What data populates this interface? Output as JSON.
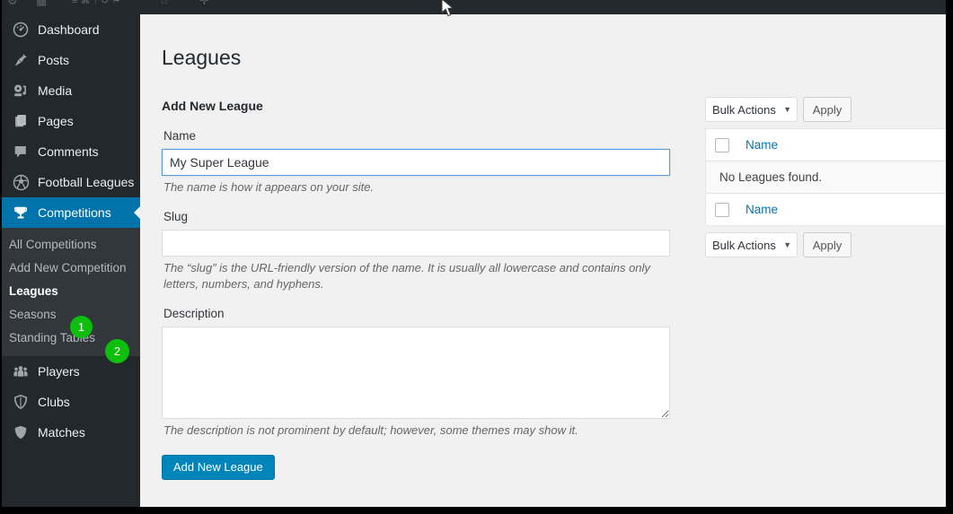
{
  "window": {
    "admin_bar_ghost_left": "≡ ⌘ ↑ ↺  ⚑",
    "cursor_icon": "mouse-pointer"
  },
  "sidebar": {
    "items": [
      {
        "label": "Dashboard",
        "icon": "gauge-icon",
        "active": false
      },
      {
        "label": "Posts",
        "icon": "pushpin-icon",
        "active": false
      },
      {
        "label": "Media",
        "icon": "media-icon",
        "active": false
      },
      {
        "label": "Pages",
        "icon": "pages-icon",
        "active": false
      },
      {
        "label": "Comments",
        "icon": "comment-bubble-icon",
        "active": false
      },
      {
        "label": "Football Leagues",
        "icon": "soccer-ball-icon",
        "active": false
      },
      {
        "label": "Competitions",
        "icon": "trophy-icon",
        "active": true
      },
      {
        "label": "Players",
        "icon": "users-group-icon",
        "active": false
      },
      {
        "label": "Clubs",
        "icon": "shield-outline-icon",
        "active": false
      },
      {
        "label": "Matches",
        "icon": "shield-filled-icon",
        "active": false
      }
    ],
    "submenu": [
      {
        "label": "All Competitions",
        "current": false
      },
      {
        "label": "Add New Competition",
        "current": false
      },
      {
        "label": "Leagues",
        "current": true
      },
      {
        "label": "Seasons",
        "current": false
      },
      {
        "label": "Standing Tables",
        "current": false
      }
    ],
    "active_color": "#0073aa",
    "background": "#23282d",
    "submenu_background": "#32373c"
  },
  "annotations": {
    "badge_color": "#0cbf0c",
    "markers": [
      {
        "number": "1",
        "target": "Leagues"
      },
      {
        "number": "2",
        "target": "Seasons"
      }
    ]
  },
  "main": {
    "page_title": "Leagues",
    "form": {
      "heading": "Add New League",
      "name": {
        "label": "Name",
        "value": "My Super League",
        "placeholder": "",
        "help": "The name is how it appears on your site."
      },
      "slug": {
        "label": "Slug",
        "value": "",
        "placeholder": "",
        "help": "The “slug” is the URL-friendly version of the name. It is usually all lowercase and contains only letters, numbers, and hyphens."
      },
      "description": {
        "label": "Description",
        "value": "",
        "placeholder": "",
        "help": "The description is not prominent by default; however, some themes may show it."
      },
      "submit_label": "Add New League"
    },
    "list": {
      "bulk_actions_top": {
        "select_value": "Bulk Actions",
        "apply_label": "Apply"
      },
      "bulk_actions_bottom": {
        "select_value": "Bulk Actions",
        "apply_label": "Apply"
      },
      "columns": [
        "Name"
      ],
      "empty_message": "No Leagues found.",
      "rows": []
    }
  }
}
